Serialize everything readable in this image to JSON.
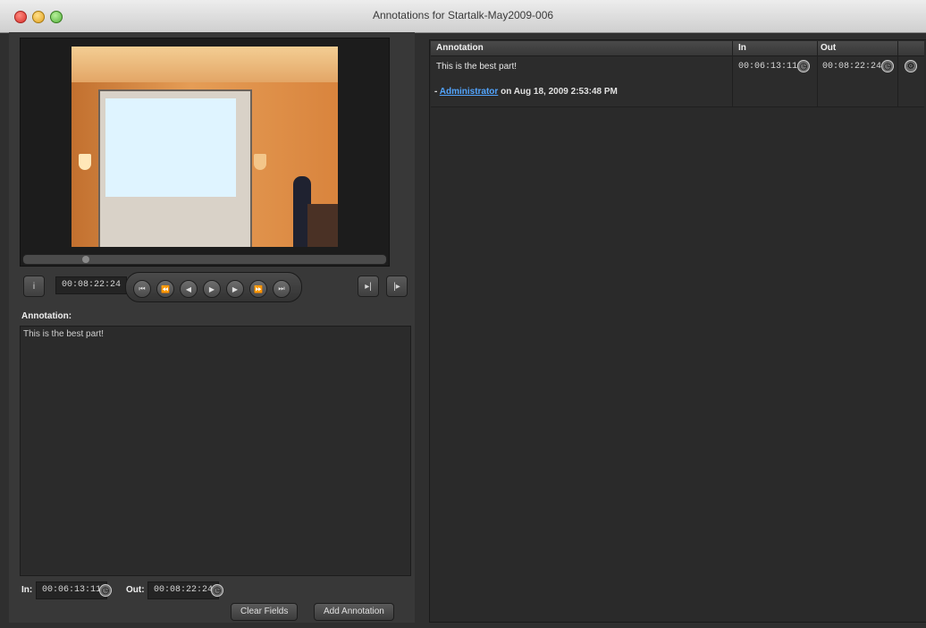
{
  "window": {
    "title": "Annotations for Startalk-May2009-006"
  },
  "player": {
    "current_time": "00:08:22:24",
    "controls": {
      "info_icon": "info-icon",
      "step_back_icon": "step-back-icon",
      "rewind_icon": "rewind-icon",
      "prev_frame_icon": "prev-frame-icon",
      "play_icon": "play-icon",
      "next_frame_icon": "next-frame-icon",
      "fast_forward_icon": "fast-forward-icon",
      "skip_end_icon": "skip-end-icon",
      "mark_in_icon": "mark-in-icon",
      "mark_out_icon": "mark-out-icon"
    }
  },
  "annotation_form": {
    "label": "Annotation:",
    "text": "This is the best part!",
    "in_label": "In:",
    "in_value": "00:06:13:11",
    "out_label": "Out:",
    "out_value": "00:08:22:24",
    "clear_button": "Clear Fields",
    "add_button": "Add Annotation"
  },
  "table": {
    "headers": [
      "Annotation",
      "In",
      "Out"
    ],
    "rows": [
      {
        "annotation": "This is the best part!",
        "in": "00:06:13:11",
        "out": "00:08:22:24",
        "author": "Administrator",
        "meta": " on Aug 18, 2009 2:53:48 PM"
      }
    ]
  },
  "colors": {
    "link": "#52a5ff"
  }
}
